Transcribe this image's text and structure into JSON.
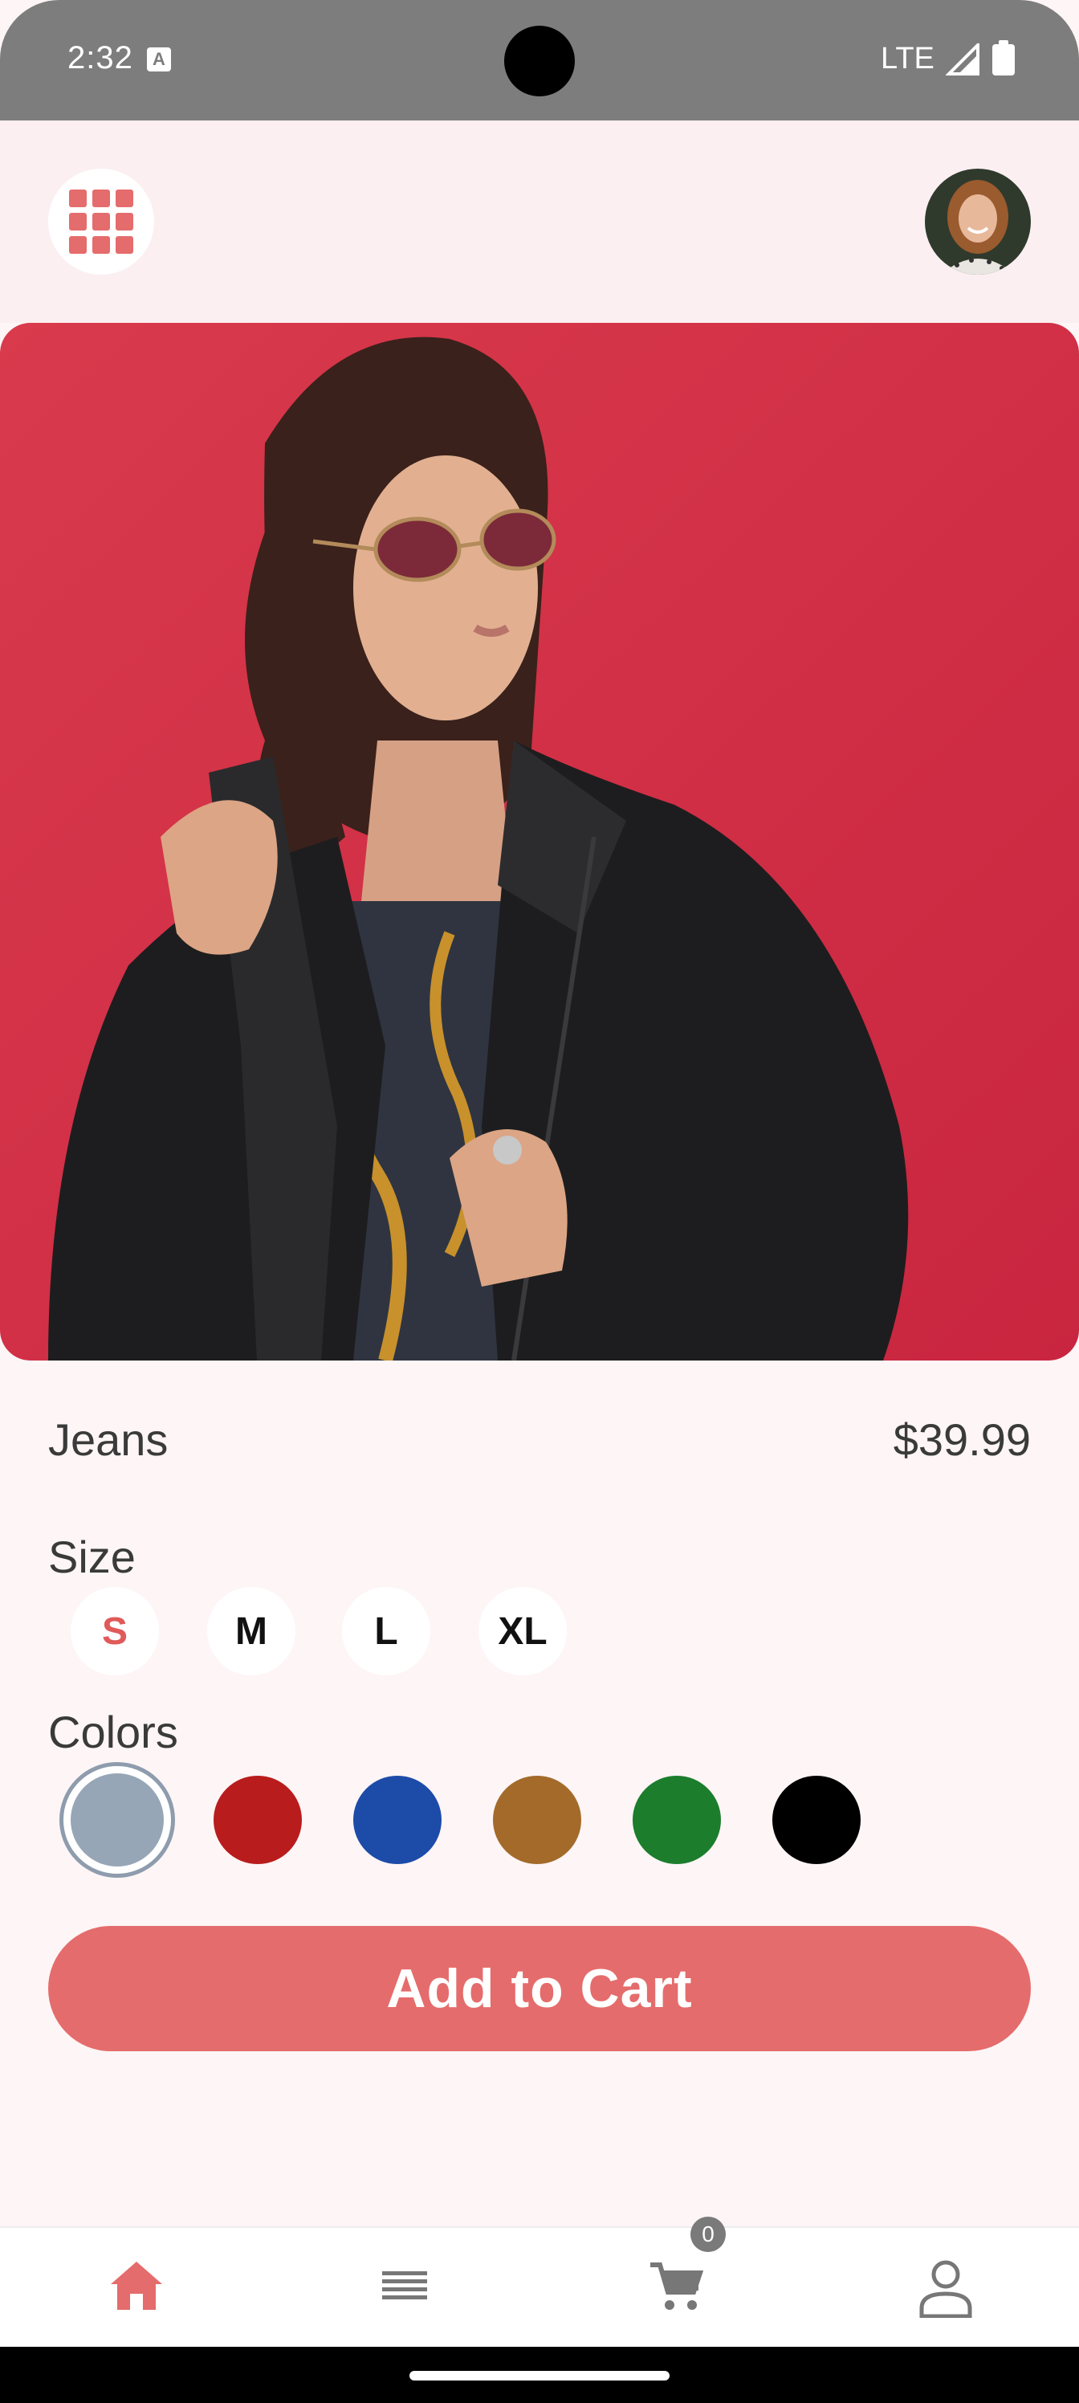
{
  "status_bar": {
    "time": "2:32",
    "network": "LTE"
  },
  "product": {
    "name": "Jeans",
    "price": "$39.99"
  },
  "size_section": {
    "label": "Size",
    "options": [
      "S",
      "M",
      "L",
      "XL"
    ],
    "selected": "S"
  },
  "color_section": {
    "label": "Colors",
    "swatches": [
      "#96a6b6",
      "#b91c1c",
      "#1d4ba8",
      "#a36a2a",
      "#1c7d2c",
      "#000000"
    ],
    "selected_index": 0
  },
  "cart_button": {
    "label": "Add to Cart"
  },
  "bottom_nav": {
    "cart_count": "0",
    "active": "home"
  },
  "colors": {
    "accent": "#e56c6c",
    "background": "#fdf5f6"
  }
}
